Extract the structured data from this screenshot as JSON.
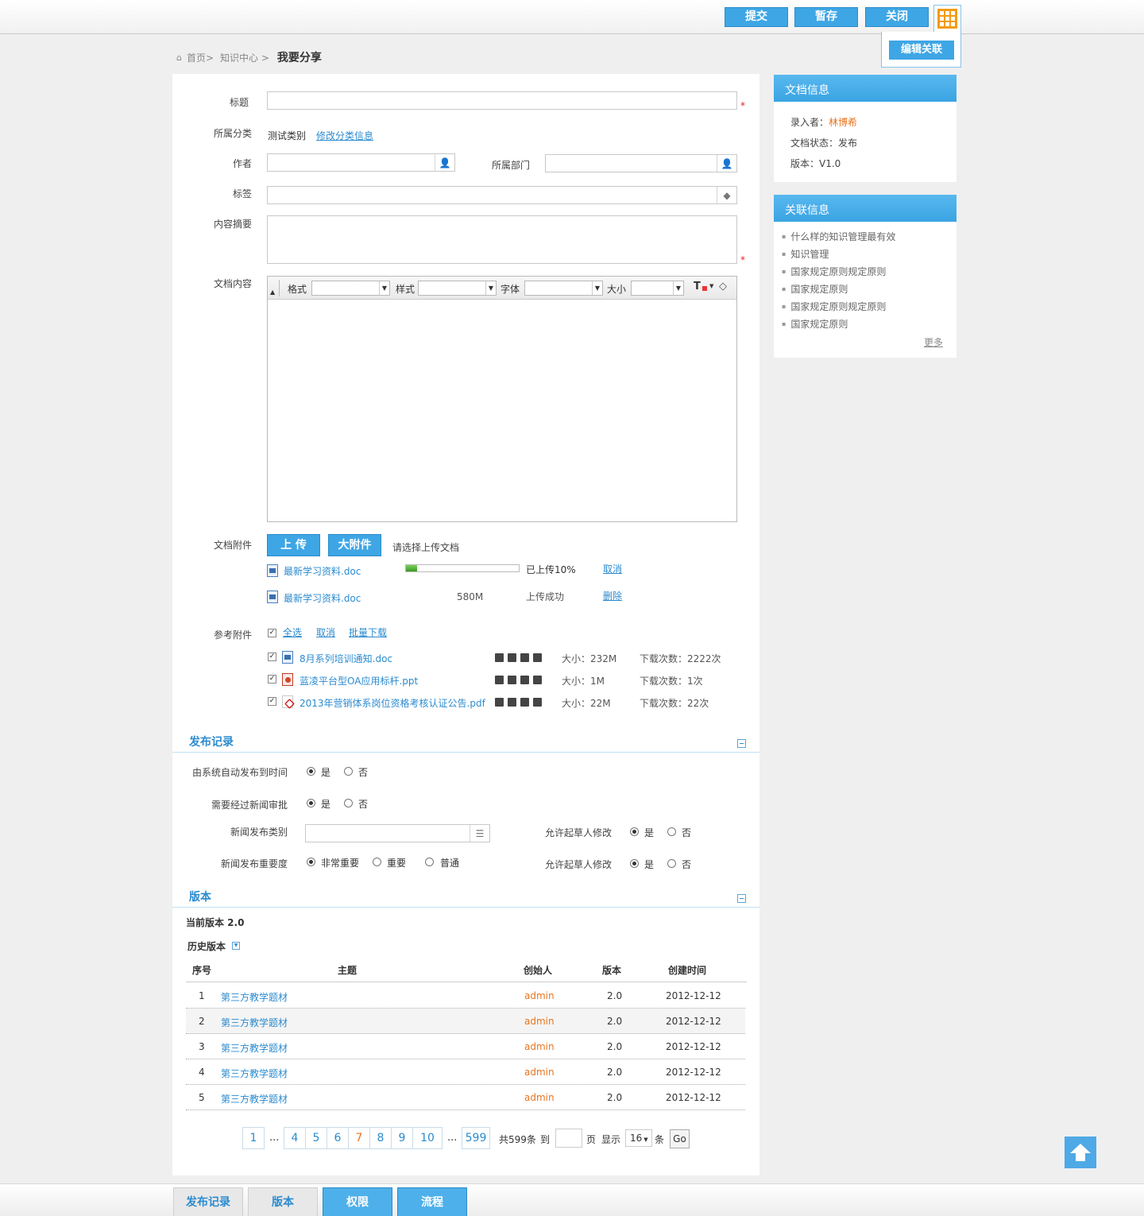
{
  "toolbar": {
    "submit": "提交",
    "save_draft": "暂存",
    "close": "关闭",
    "edit_relation": "编辑关联"
  },
  "breadcrumb": {
    "home": "首页>",
    "center": "知识中心 >",
    "current": "我要分享"
  },
  "form": {
    "title_label": "标题",
    "category_label": "所属分类",
    "category_value": "测试类别",
    "category_edit_link": "修改分类信息",
    "author_label": "作者",
    "dept_label": "所属部门",
    "tags_label": "标签",
    "summary_label": "内容摘要",
    "content_label": "文档内容",
    "required_mark": "*",
    "editor": {
      "format_label": "格式",
      "style_label": "样式",
      "font_label": "字体",
      "size_label": "大小"
    }
  },
  "attachments": {
    "label": "文档附件",
    "upload_btn": "上 传",
    "big_btn": "大附件",
    "hint": "请选择上传文档",
    "files": [
      {
        "name": "最新学习资料.doc",
        "progress": 0.1,
        "status": "已上传10%",
        "action": "取消"
      },
      {
        "name": "最新学习资料.doc",
        "size": "580M",
        "status": "上传成功",
        "action": "删除"
      }
    ]
  },
  "refs": {
    "label": "参考附件",
    "select_all": "全选",
    "cancel": "取消",
    "batch_download": "批量下载",
    "items": [
      {
        "name": "8月系列培训通知.doc",
        "type": "doc",
        "size": "大小：232M",
        "downloads": "下载次数：2222次"
      },
      {
        "name": "蓝凌平台型OA应用标杆.ppt",
        "type": "ppt",
        "size": "大小：1M",
        "downloads": "下载次数：1次"
      },
      {
        "name": "2013年营销体系岗位资格考核认证公告.pdf",
        "type": "pdf",
        "size": "大小：22M",
        "downloads": "下载次数：22次"
      }
    ]
  },
  "publish": {
    "section_title": "发布记录",
    "auto_publish_label": "由系统自动发布到时间",
    "news_approval_label": "需要经过新闻审批",
    "news_category_label": "新闻发布类别",
    "news_importance_label": "新闻发布重要度",
    "allow_modify_label_1": "允许起草人修改",
    "allow_modify_label_2": "允许起草人修改",
    "yes": "是",
    "no": "否",
    "importance_options": [
      "非常重要",
      "重要",
      "普通"
    ]
  },
  "version": {
    "section_title": "版本",
    "current": "当前版本 2.0",
    "history_label": "历史版本",
    "columns": [
      "序号",
      "主题",
      "创始人",
      "版本",
      "创建时间"
    ],
    "rows": [
      {
        "no": "1",
        "subject": "第三方教学题材",
        "creator": "admin",
        "version": "2.0",
        "date": "2012-12-12"
      },
      {
        "no": "2",
        "subject": "第三方教学题材",
        "creator": "admin",
        "version": "2.0",
        "date": "2012-12-12"
      },
      {
        "no": "3",
        "subject": "第三方教学题材",
        "creator": "admin",
        "version": "2.0",
        "date": "2012-12-12"
      },
      {
        "no": "4",
        "subject": "第三方教学题材",
        "creator": "admin",
        "version": "2.0",
        "date": "2012-12-12"
      },
      {
        "no": "5",
        "subject": "第三方教学题材",
        "creator": "admin",
        "version": "2.0",
        "date": "2012-12-12"
      }
    ]
  },
  "pager": {
    "pages": [
      "1",
      "4",
      "5",
      "6",
      "7",
      "8",
      "9",
      "10",
      "599"
    ],
    "ellipsis": "...",
    "current": "7",
    "total": "共599条",
    "goto": "到",
    "page_unit": "页",
    "show": "显示",
    "page_size": "16",
    "per_unit": "条",
    "go": "Go"
  },
  "doc_info": {
    "title": "文档信息",
    "recorder_label": "录入者：",
    "recorder": "林博希",
    "status": "文档状态：发布",
    "version": "版本：V1.0"
  },
  "related": {
    "title": "关联信息",
    "items": [
      "什么样的知识管理最有效",
      "知识管理",
      "国家规定原则规定原则",
      "国家规定原则",
      "国家规定原则规定原则",
      "国家规定原则"
    ],
    "more": "更多"
  },
  "bottom_tabs": [
    "发布记录",
    "版本",
    "权限",
    "流程"
  ],
  "colors": {
    "accent": "#3ea6e5",
    "link": "#2b8bcf",
    "orange": "#e8741e"
  }
}
